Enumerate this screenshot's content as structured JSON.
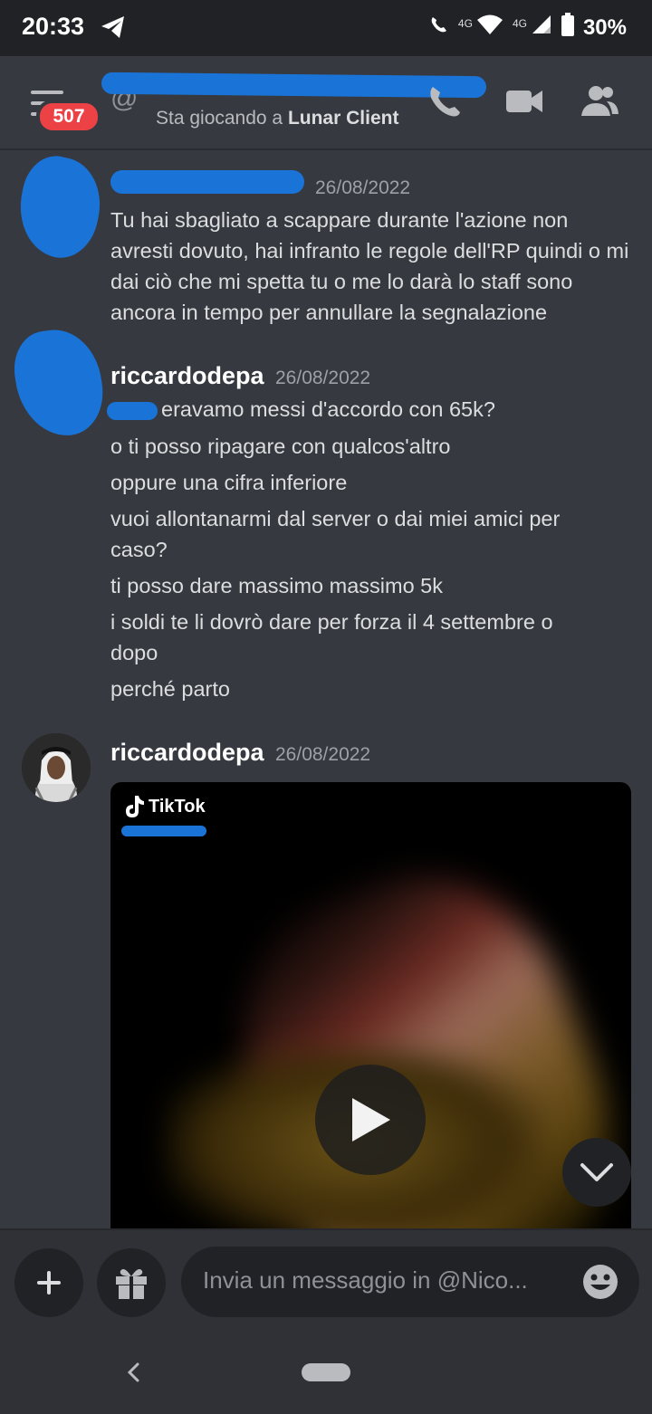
{
  "status_bar": {
    "time": "20:33",
    "network_left": "4G",
    "network_right": "4G",
    "battery": "30%"
  },
  "header": {
    "badge_count": "507",
    "activity_prefix": "Sta giocando a",
    "activity_game": "Lunar Client"
  },
  "messages": [
    {
      "author": "",
      "timestamp": "26/08/2022",
      "lines": [
        "Tu hai sbagliato a scappare durante l'azione non avresti dovuto, hai infranto le regole dell'RP quindi o mi dai ciò che mi spetta tu o me lo darà lo staff sono ancora in tempo per annullare la segnalazione"
      ]
    },
    {
      "author": "riccardodepa",
      "timestamp": "26/08/2022",
      "lines": [
        "eravamo messi d'accordo con 65k?",
        "o ti posso ripagare con qualcos'altro",
        "oppure una cifra inferiore",
        "vuoi allontanarmi dal server o dai miei amici per caso?",
        "ti posso dare massimo massimo 5k",
        "i soldi te li dovrò dare per forza il 4 settembre o dopo",
        "perché parto"
      ]
    },
    {
      "author": "riccardodepa",
      "timestamp": "26/08/2022",
      "embed": {
        "brand": "TikTok"
      }
    }
  ],
  "composer": {
    "placeholder": "Invia un messaggio in @Nico..."
  },
  "icons": {
    "telegram": "telegram-icon",
    "call": "phone-call-icon",
    "video": "video-camera-icon",
    "members": "members-icon",
    "add": "plus-icon",
    "gift": "gift-icon",
    "emoji": "emoji-icon"
  },
  "colors": {
    "background": "#36393f",
    "badge": "#ed4245",
    "redaction": "#1a74d8"
  }
}
